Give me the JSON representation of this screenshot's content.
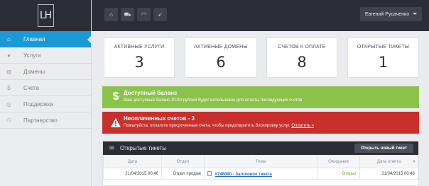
{
  "logo": {
    "text": "LH"
  },
  "sidebar": {
    "items": [
      {
        "label": "Главная",
        "icon": "home-icon",
        "glyph": "⌂",
        "active": true
      },
      {
        "label": "Услуги",
        "icon": "user-icon",
        "glyph": "●",
        "active": false
      },
      {
        "label": "Домены",
        "icon": "globe-icon",
        "glyph": "◍",
        "active": false
      },
      {
        "label": "Счета",
        "icon": "dollar-icon",
        "glyph": "$",
        "active": false
      },
      {
        "label": "Поддержка",
        "icon": "lifebuoy-icon",
        "glyph": "◎",
        "active": false
      },
      {
        "label": "Партнерство",
        "icon": "users-icon",
        "glyph": "⚇",
        "active": false
      }
    ]
  },
  "topbar": {
    "buttons": [
      {
        "icon": "home-icon",
        "glyph": "⌂"
      },
      {
        "icon": "cart-icon",
        "glyph": "⛟"
      },
      {
        "icon": "wifi-icon",
        "glyph": "◠"
      },
      {
        "icon": "rocket-icon",
        "glyph": "➶"
      }
    ],
    "user": "Евгений Русаченко"
  },
  "stats": [
    {
      "label": "АКТИВНЫЕ УСЛУГИ",
      "value": "3"
    },
    {
      "label": "АКТИВНЫЕ ДОМЕНЫ",
      "value": "6"
    },
    {
      "label": "СЧЕТОВ К ОПЛАТЕ",
      "value": "8"
    },
    {
      "label": "ОТКРЫТЫЕ ТИКЕТЫ",
      "value": "1"
    }
  ],
  "alerts": {
    "balance": {
      "icon": "dollar-icon",
      "title": "Доступный баланс",
      "text": "Ваш доступный баланс 10.00 рублей будет использован для оплаты последующих счетов",
      "color": "#8bc34a"
    },
    "unpaid": {
      "icon": "warning-icon",
      "title": "Неоплаченных счетов - 3",
      "text": "Пожалуйста, оплатите просроченные счета, чтобы предотвратить блокировку услуг.",
      "link": "Оплатить »",
      "color": "#c9302c"
    }
  },
  "tickets": {
    "title": "Открытые тикеты",
    "new_button": "Открыть новый тикет",
    "columns": [
      "Дата",
      "Отдел",
      "Тема",
      "Ожидание",
      "Дата ответа"
    ],
    "rows": [
      {
        "date": "21/04/2015 00:46",
        "dept": "Отдел продаж",
        "subject": "#746890 - Заголовок тикета",
        "status": "Открыт",
        "last": "21/04/2015 00:46"
      }
    ]
  }
}
